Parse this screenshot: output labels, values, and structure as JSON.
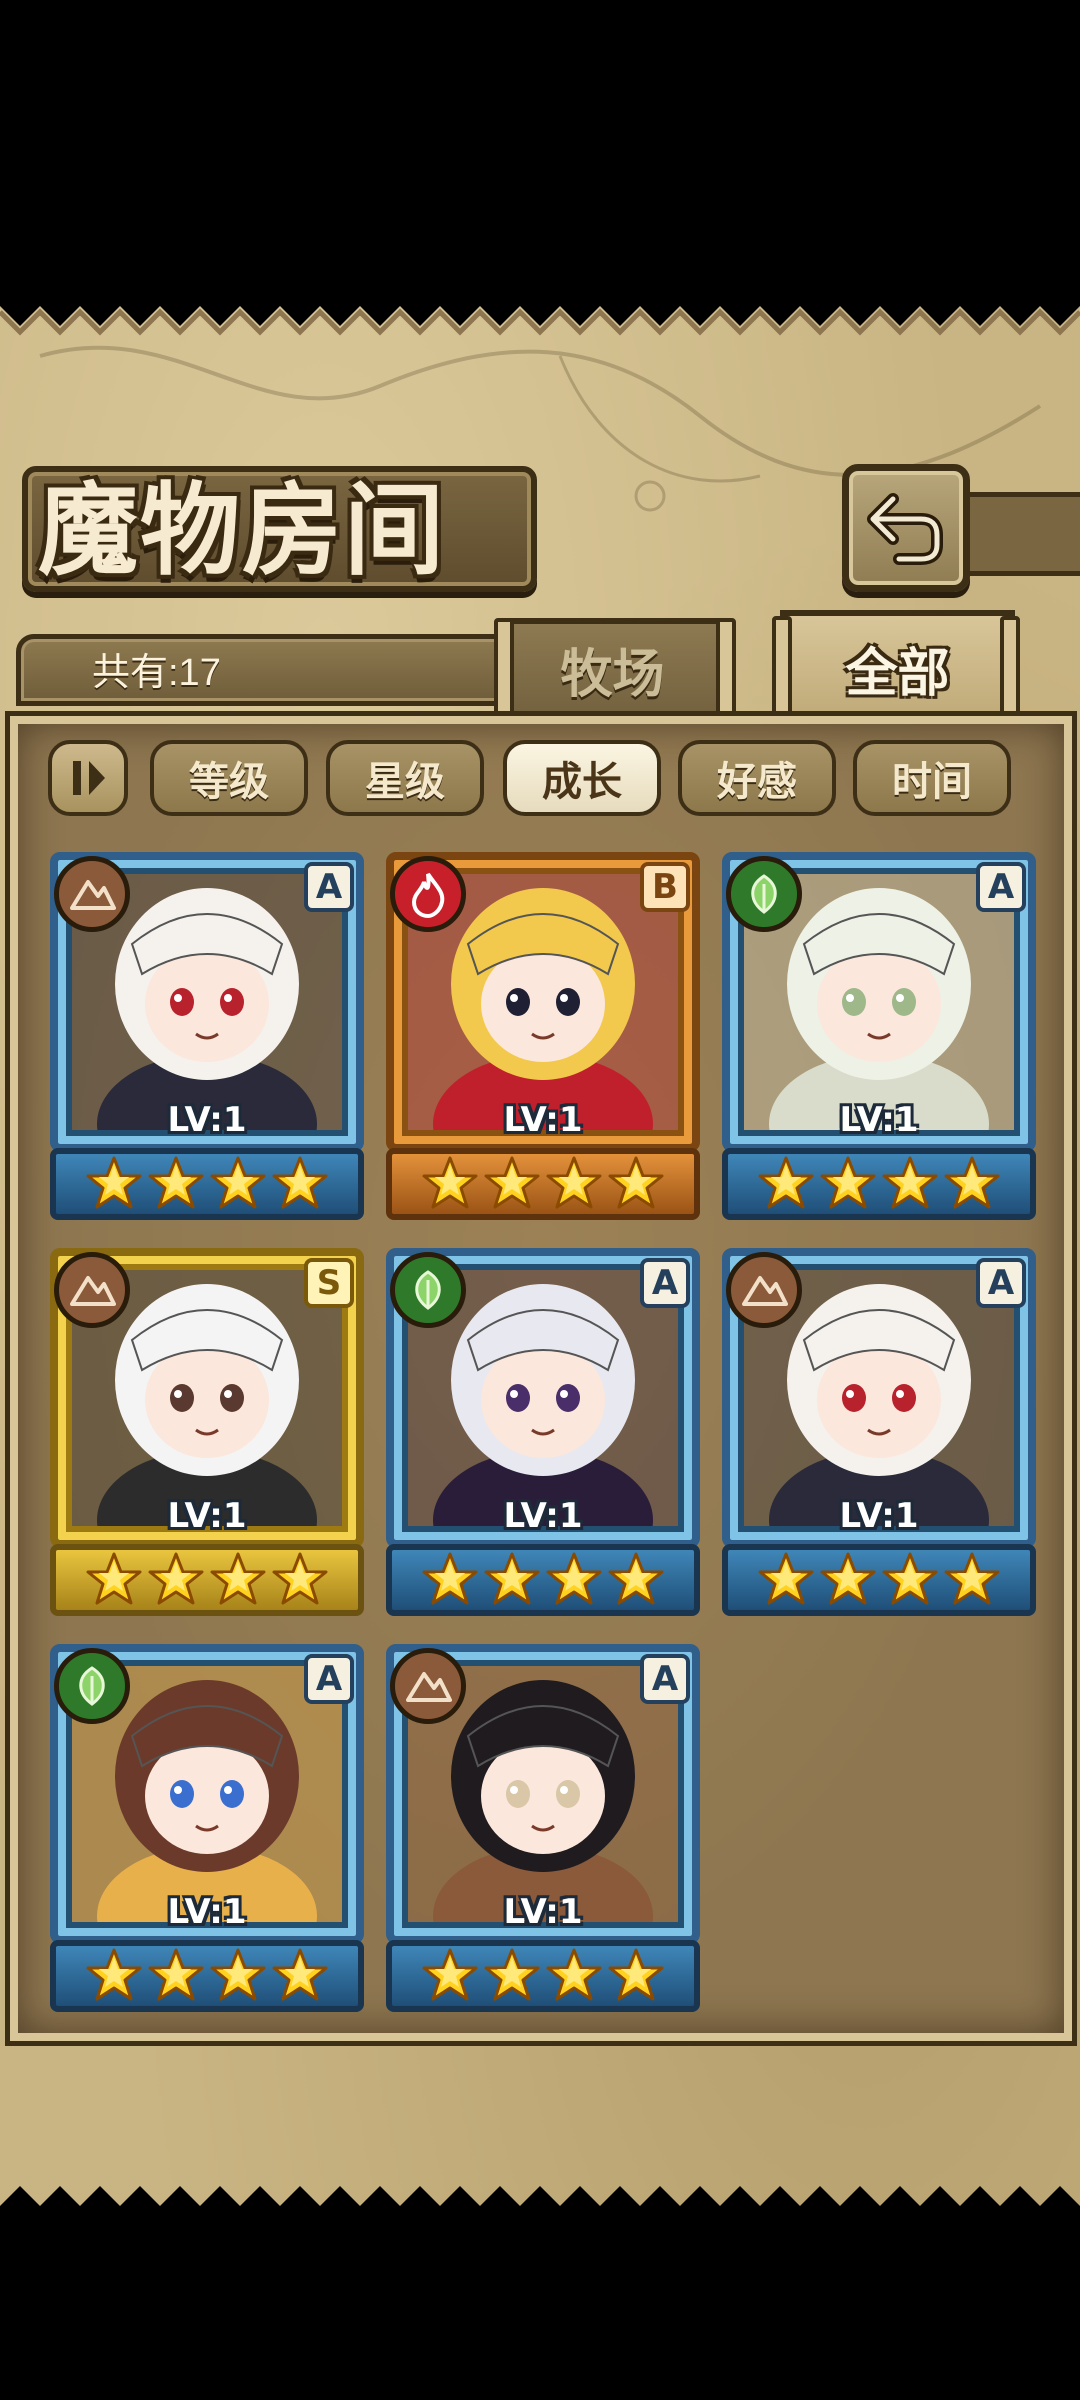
{
  "header": {
    "title": "魔物房间",
    "back_icon": "return-arrow-icon"
  },
  "tabs": {
    "count_label": "共有:17",
    "pasture_label": "牧场",
    "all_label": "全部",
    "active": "全部"
  },
  "sort": {
    "toggle_icon": "sort-order-icon",
    "options": [
      "等级",
      "星级",
      "成长",
      "好感",
      "时间"
    ],
    "active": "成长"
  },
  "monsters": [
    {
      "level_label": "LV:1",
      "rank": "A",
      "element": "earth",
      "stars": 4,
      "frame": "blue"
    },
    {
      "level_label": "LV:1",
      "rank": "B",
      "element": "fire",
      "stars": 4,
      "frame": "orange"
    },
    {
      "level_label": "LV:1",
      "rank": "A",
      "element": "leaf",
      "stars": 4,
      "frame": "blue"
    },
    {
      "level_label": "LV:1",
      "rank": "S",
      "element": "earth",
      "stars": 4,
      "frame": "gold"
    },
    {
      "level_label": "LV:1",
      "rank": "A",
      "element": "leaf",
      "stars": 4,
      "frame": "blue"
    },
    {
      "level_label": "LV:1",
      "rank": "A",
      "element": "earth",
      "stars": 4,
      "frame": "blue"
    },
    {
      "level_label": "LV:1",
      "rank": "A",
      "element": "leaf",
      "stars": 4,
      "frame": "blue"
    },
    {
      "level_label": "LV:1",
      "rank": "A",
      "element": "earth",
      "stars": 4,
      "frame": "blue"
    }
  ],
  "colors": {
    "parchment": "#c9b583",
    "frame_dark": "#3d2e16",
    "card_blue": "#7fc3e6",
    "card_gold": "#f3d24e",
    "card_orange": "#e99a3b",
    "element_earth": "#8a5a3a",
    "element_fire": "#c8202a",
    "element_leaf": "#2f7a2a"
  }
}
